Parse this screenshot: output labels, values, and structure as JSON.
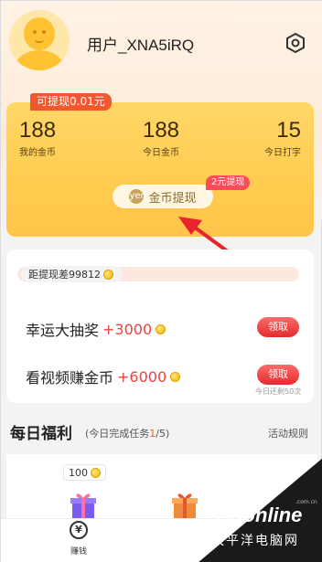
{
  "header": {
    "username": "用户_XNA5iRQ",
    "avatar_icon": "default-avatar-icon",
    "settings_icon": "hexagon-settings-icon"
  },
  "card": {
    "withdraw_tag": "可提现0.01元",
    "stats": [
      {
        "value": "188",
        "label": "我的金币"
      },
      {
        "value": "188",
        "label": "今日金币"
      },
      {
        "value": "15",
        "label": "今日打字"
      }
    ],
    "coin_withdraw_label": "金币提现",
    "coin_withdraw_icon": "yen",
    "badge": "2元提现",
    "gradient_top": "#ffd767",
    "gradient_bottom": "#ffc54a"
  },
  "progress": {
    "label": "距提现差99812",
    "accent": "#fde8e0"
  },
  "tasks": [
    {
      "title": "幸运大抽奖",
      "reward": "+3000",
      "button": "领取"
    },
    {
      "title": "看视频赚金币",
      "reward": "+6000",
      "button": "领取"
    }
  ],
  "remaining_note": "今日还剩50次",
  "daily": {
    "title": "每日福利",
    "progress_prefix": "(今日完成任务",
    "progress_done": "1",
    "progress_suffix": "/5)",
    "rules_link": "活动规则"
  },
  "rewards": {
    "amount": "100"
  },
  "bottom_nav": {
    "earn_label": "赚钱",
    "earn_icon": "¥"
  },
  "watermark": {
    "logo": "PConline",
    "sub": ".com.cn",
    "cn": "太平洋电脑网"
  }
}
